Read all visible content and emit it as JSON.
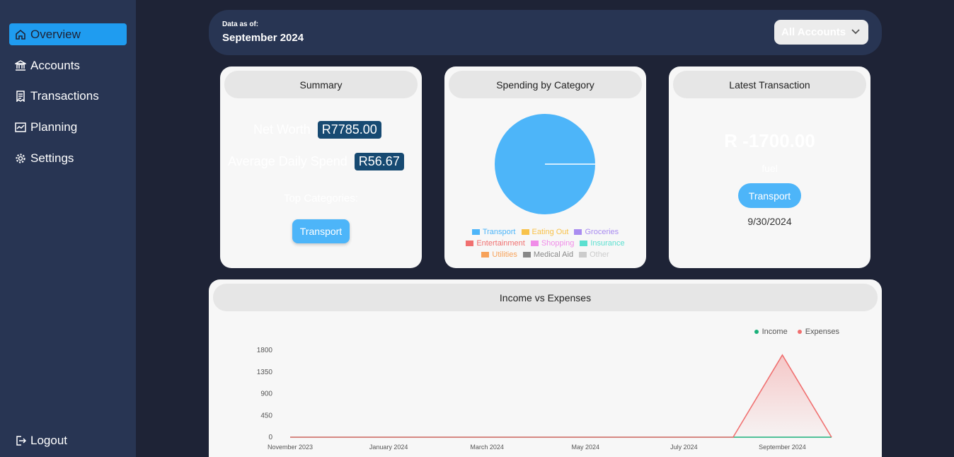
{
  "sidebar": {
    "items": [
      {
        "label": "Overview",
        "icon": "home-icon",
        "active": true
      },
      {
        "label": "Accounts",
        "icon": "bank-icon"
      },
      {
        "label": "Transactions",
        "icon": "receipt-icon"
      },
      {
        "label": "Planning",
        "icon": "chart-icon"
      },
      {
        "label": "Settings",
        "icon": "gear-icon"
      }
    ],
    "logout": "Logout"
  },
  "header": {
    "label": "Data as of:",
    "month": "September 2024",
    "account_select": "All Accounts"
  },
  "summary": {
    "title": "Summary",
    "net_worth_label": "Net Worth",
    "net_worth": "R7785.00",
    "avg_spend_label": "Average Daily Spend",
    "avg_spend": "R56.67",
    "top_categories_label": "Top Categories:",
    "top_category": "Transport"
  },
  "spending": {
    "title": "Spending by Category",
    "legend_row1": [
      "Transport",
      "Eating Out",
      "Groceries"
    ],
    "legend_row2": [
      "Entertainment",
      "Shopping",
      "Insurance"
    ],
    "legend_row3": [
      "Utilities",
      "Medical Aid",
      "Other"
    ],
    "colors": {
      "Transport": "#4db5f9",
      "Eating Out": "#f8c24a",
      "Groceries": "#a98cf0",
      "Entertainment": "#f07070",
      "Shopping": "#f08ce8",
      "Insurance": "#5be0d0",
      "Utilities": "#f7a25a",
      "Medical Aid": "#888888",
      "Other": "#cccccc"
    },
    "slices": [
      {
        "category": "Transport",
        "share": 1.0
      }
    ]
  },
  "latest": {
    "title": "Latest Transaction",
    "amount": "R -1700.00",
    "description": "fuel",
    "category": "Transport",
    "date": "9/30/2024"
  },
  "income_expenses": {
    "title": "Income vs Expenses",
    "legend_income": "Income",
    "legend_expenses": "Expenses"
  },
  "chart_data": {
    "type": "area",
    "title": "Income vs Expenses",
    "x": [
      "November 2023",
      "December 2023",
      "January 2024",
      "February 2024",
      "March 2024",
      "April 2024",
      "May 2024",
      "June 2024",
      "July 2024",
      "August 2024",
      "September 2024",
      "October 2024"
    ],
    "x_tick_labels": [
      "November 2023",
      "January 2024",
      "March 2024",
      "May 2024",
      "July 2024",
      "September 2024"
    ],
    "y_ticks": [
      0,
      450,
      900,
      1350,
      1800
    ],
    "ylim": [
      0,
      1800
    ],
    "series": [
      {
        "name": "Income",
        "color": "#1bb07a",
        "values": [
          0,
          0,
          0,
          0,
          0,
          0,
          0,
          0,
          0,
          0,
          0,
          0
        ]
      },
      {
        "name": "Expenses",
        "color": "#f07070",
        "values": [
          0,
          0,
          0,
          0,
          0,
          0,
          0,
          0,
          0,
          0,
          1700,
          0
        ]
      }
    ]
  }
}
